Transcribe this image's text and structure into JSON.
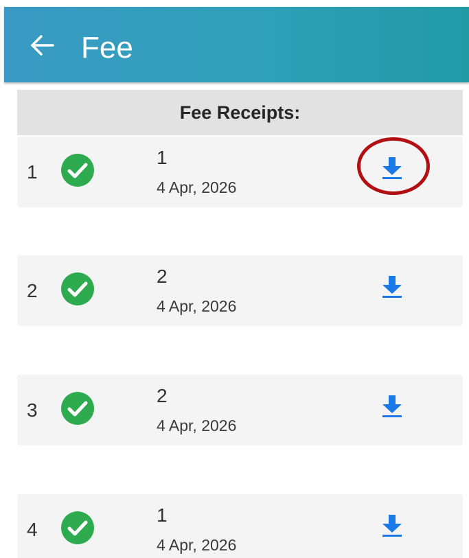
{
  "header": {
    "title": "Fee",
    "back_icon": "arrow-left-icon",
    "background_start": "#3a9ac4",
    "background_end": "#229aa6"
  },
  "section": {
    "title": "Fee Receipts:"
  },
  "receipts": [
    {
      "index": "1",
      "status_icon": "check-circle-icon",
      "amount": "1",
      "date": "4 Apr, 2026",
      "action_icon": "download-icon"
    },
    {
      "index": "2",
      "status_icon": "check-circle-icon",
      "amount": "2",
      "date": "4 Apr, 2026",
      "action_icon": "download-icon"
    },
    {
      "index": "3",
      "status_icon": "check-circle-icon",
      "amount": "2",
      "date": "4 Apr, 2026",
      "action_icon": "download-icon"
    },
    {
      "index": "4",
      "status_icon": "check-circle-icon",
      "amount": "1",
      "date": "4 Apr, 2026",
      "action_icon": "download-icon"
    }
  ],
  "colors": {
    "status_paid": "#2eaa4f",
    "download_accent": "#1a78e8",
    "highlight_ring": "#b20f12",
    "card_background": "#f4f4f4",
    "section_header_background": "#e2e2e2"
  }
}
